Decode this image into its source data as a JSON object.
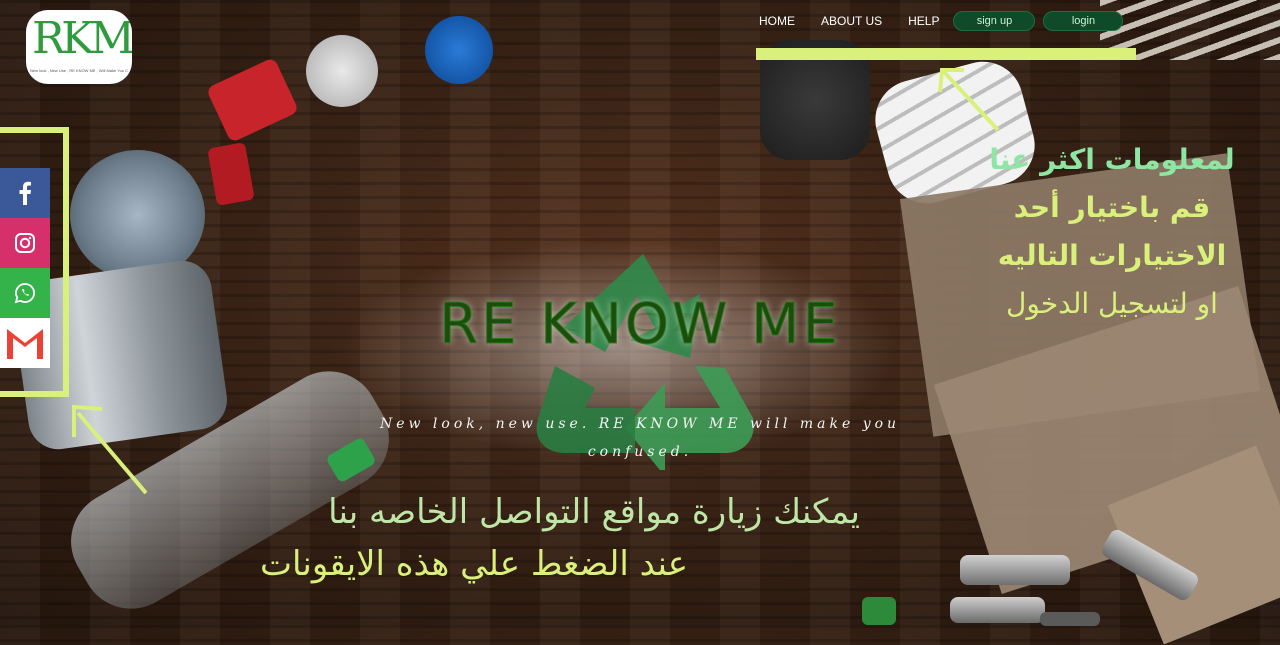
{
  "logo": {
    "mark": "RKM",
    "tagline": "New look , New Use , RE KNOW ME , Will Make You Confused"
  },
  "nav": {
    "home": "HOME",
    "about": "ABOUT US",
    "help": "HELP",
    "signup": "sign up",
    "login": "login"
  },
  "social": [
    {
      "name": "facebook",
      "icon": "facebook-icon",
      "color": "#3b5998"
    },
    {
      "name": "instagram",
      "icon": "instagram-icon",
      "color": "#d6306a"
    },
    {
      "name": "whatsapp",
      "icon": "whatsapp-icon",
      "color": "#34b34a"
    },
    {
      "name": "gmail",
      "icon": "gmail-icon",
      "color": "#ea4335"
    }
  ],
  "hero": {
    "title": "RE KNOW ME",
    "tagline_line1": "New look, new use. RE KNOW ME will make you",
    "tagline_line2": "confused."
  },
  "annotations": {
    "right": {
      "line1": "لمعلومات اكثر عنا",
      "line2": "قم باختيار أحد",
      "line3": "الاختيارات التاليه",
      "line4": "او لتسجيل الدخول"
    },
    "bottom": {
      "line1": "يمكنك زيارة مواقع التواصل الخاصه بنا",
      "line2": "عند الضغط علي هذه الايقونات"
    }
  },
  "colors": {
    "highlight": "#d9f07a",
    "title_green": "#1b4d0e",
    "pill_bg": "#0f4a2a",
    "recycle_green": "#2f8a4a"
  }
}
